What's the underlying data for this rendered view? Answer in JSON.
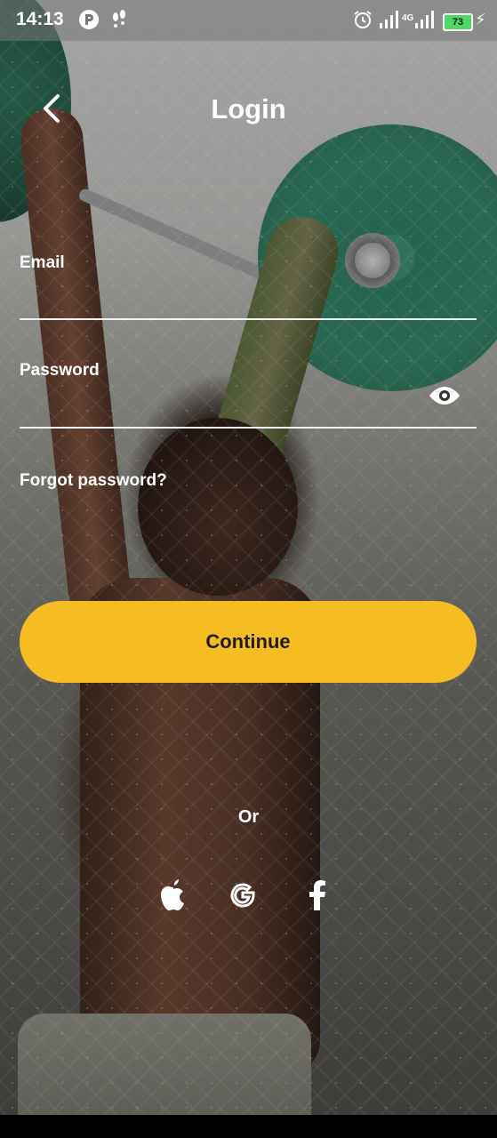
{
  "status_bar": {
    "time": "14:13",
    "network_type": "4G",
    "battery_level": "73",
    "icons": [
      "app-notification-icon",
      "footsteps-icon",
      "alarm-icon",
      "signal-icon",
      "signal-4g-icon",
      "battery-icon",
      "charging-icon"
    ]
  },
  "header": {
    "title": "Login",
    "back_icon": "chevron-left-icon"
  },
  "form": {
    "email": {
      "label": "Email",
      "value": "",
      "placeholder": ""
    },
    "password": {
      "label": "Password",
      "value": "",
      "placeholder": "",
      "toggle_icon": "eye-icon"
    },
    "forgot_password": "Forgot password?",
    "continue_label": "Continue"
  },
  "social": {
    "divider_text": "Or",
    "providers": [
      "apple-icon",
      "google-icon",
      "facebook-icon"
    ]
  },
  "colors": {
    "accent": "#f5bd22",
    "button_text": "#1e1e1e",
    "text": "#ffffff"
  }
}
